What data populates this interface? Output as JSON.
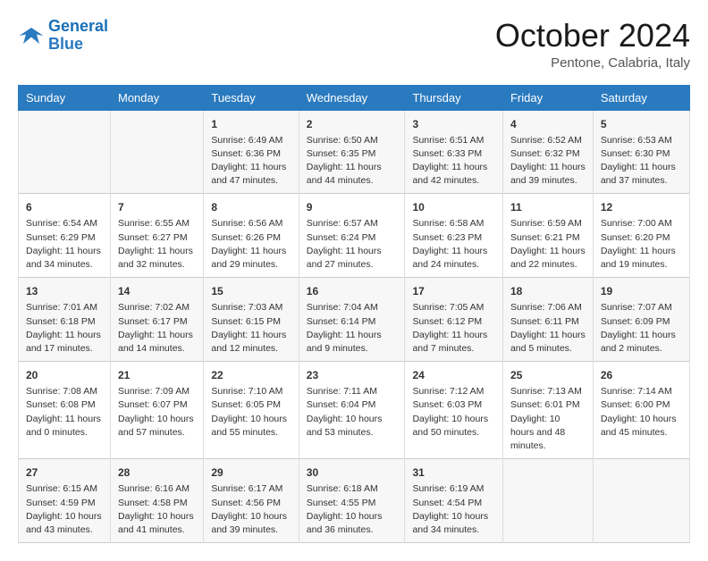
{
  "header": {
    "logo_line1": "General",
    "logo_line2": "Blue",
    "month": "October 2024",
    "location": "Pentone, Calabria, Italy"
  },
  "days_of_week": [
    "Sunday",
    "Monday",
    "Tuesday",
    "Wednesday",
    "Thursday",
    "Friday",
    "Saturday"
  ],
  "weeks": [
    [
      {
        "day": "",
        "content": ""
      },
      {
        "day": "",
        "content": ""
      },
      {
        "day": "1",
        "content": "Sunrise: 6:49 AM\nSunset: 6:36 PM\nDaylight: 11 hours and 47 minutes."
      },
      {
        "day": "2",
        "content": "Sunrise: 6:50 AM\nSunset: 6:35 PM\nDaylight: 11 hours and 44 minutes."
      },
      {
        "day": "3",
        "content": "Sunrise: 6:51 AM\nSunset: 6:33 PM\nDaylight: 11 hours and 42 minutes."
      },
      {
        "day": "4",
        "content": "Sunrise: 6:52 AM\nSunset: 6:32 PM\nDaylight: 11 hours and 39 minutes."
      },
      {
        "day": "5",
        "content": "Sunrise: 6:53 AM\nSunset: 6:30 PM\nDaylight: 11 hours and 37 minutes."
      }
    ],
    [
      {
        "day": "6",
        "content": "Sunrise: 6:54 AM\nSunset: 6:29 PM\nDaylight: 11 hours and 34 minutes."
      },
      {
        "day": "7",
        "content": "Sunrise: 6:55 AM\nSunset: 6:27 PM\nDaylight: 11 hours and 32 minutes."
      },
      {
        "day": "8",
        "content": "Sunrise: 6:56 AM\nSunset: 6:26 PM\nDaylight: 11 hours and 29 minutes."
      },
      {
        "day": "9",
        "content": "Sunrise: 6:57 AM\nSunset: 6:24 PM\nDaylight: 11 hours and 27 minutes."
      },
      {
        "day": "10",
        "content": "Sunrise: 6:58 AM\nSunset: 6:23 PM\nDaylight: 11 hours and 24 minutes."
      },
      {
        "day": "11",
        "content": "Sunrise: 6:59 AM\nSunset: 6:21 PM\nDaylight: 11 hours and 22 minutes."
      },
      {
        "day": "12",
        "content": "Sunrise: 7:00 AM\nSunset: 6:20 PM\nDaylight: 11 hours and 19 minutes."
      }
    ],
    [
      {
        "day": "13",
        "content": "Sunrise: 7:01 AM\nSunset: 6:18 PM\nDaylight: 11 hours and 17 minutes."
      },
      {
        "day": "14",
        "content": "Sunrise: 7:02 AM\nSunset: 6:17 PM\nDaylight: 11 hours and 14 minutes."
      },
      {
        "day": "15",
        "content": "Sunrise: 7:03 AM\nSunset: 6:15 PM\nDaylight: 11 hours and 12 minutes."
      },
      {
        "day": "16",
        "content": "Sunrise: 7:04 AM\nSunset: 6:14 PM\nDaylight: 11 hours and 9 minutes."
      },
      {
        "day": "17",
        "content": "Sunrise: 7:05 AM\nSunset: 6:12 PM\nDaylight: 11 hours and 7 minutes."
      },
      {
        "day": "18",
        "content": "Sunrise: 7:06 AM\nSunset: 6:11 PM\nDaylight: 11 hours and 5 minutes."
      },
      {
        "day": "19",
        "content": "Sunrise: 7:07 AM\nSunset: 6:09 PM\nDaylight: 11 hours and 2 minutes."
      }
    ],
    [
      {
        "day": "20",
        "content": "Sunrise: 7:08 AM\nSunset: 6:08 PM\nDaylight: 11 hours and 0 minutes."
      },
      {
        "day": "21",
        "content": "Sunrise: 7:09 AM\nSunset: 6:07 PM\nDaylight: 10 hours and 57 minutes."
      },
      {
        "day": "22",
        "content": "Sunrise: 7:10 AM\nSunset: 6:05 PM\nDaylight: 10 hours and 55 minutes."
      },
      {
        "day": "23",
        "content": "Sunrise: 7:11 AM\nSunset: 6:04 PM\nDaylight: 10 hours and 53 minutes."
      },
      {
        "day": "24",
        "content": "Sunrise: 7:12 AM\nSunset: 6:03 PM\nDaylight: 10 hours and 50 minutes."
      },
      {
        "day": "25",
        "content": "Sunrise: 7:13 AM\nSunset: 6:01 PM\nDaylight: 10 hours and 48 minutes."
      },
      {
        "day": "26",
        "content": "Sunrise: 7:14 AM\nSunset: 6:00 PM\nDaylight: 10 hours and 45 minutes."
      }
    ],
    [
      {
        "day": "27",
        "content": "Sunrise: 6:15 AM\nSunset: 4:59 PM\nDaylight: 10 hours and 43 minutes."
      },
      {
        "day": "28",
        "content": "Sunrise: 6:16 AM\nSunset: 4:58 PM\nDaylight: 10 hours and 41 minutes."
      },
      {
        "day": "29",
        "content": "Sunrise: 6:17 AM\nSunset: 4:56 PM\nDaylight: 10 hours and 39 minutes."
      },
      {
        "day": "30",
        "content": "Sunrise: 6:18 AM\nSunset: 4:55 PM\nDaylight: 10 hours and 36 minutes."
      },
      {
        "day": "31",
        "content": "Sunrise: 6:19 AM\nSunset: 4:54 PM\nDaylight: 10 hours and 34 minutes."
      },
      {
        "day": "",
        "content": ""
      },
      {
        "day": "",
        "content": ""
      }
    ]
  ]
}
